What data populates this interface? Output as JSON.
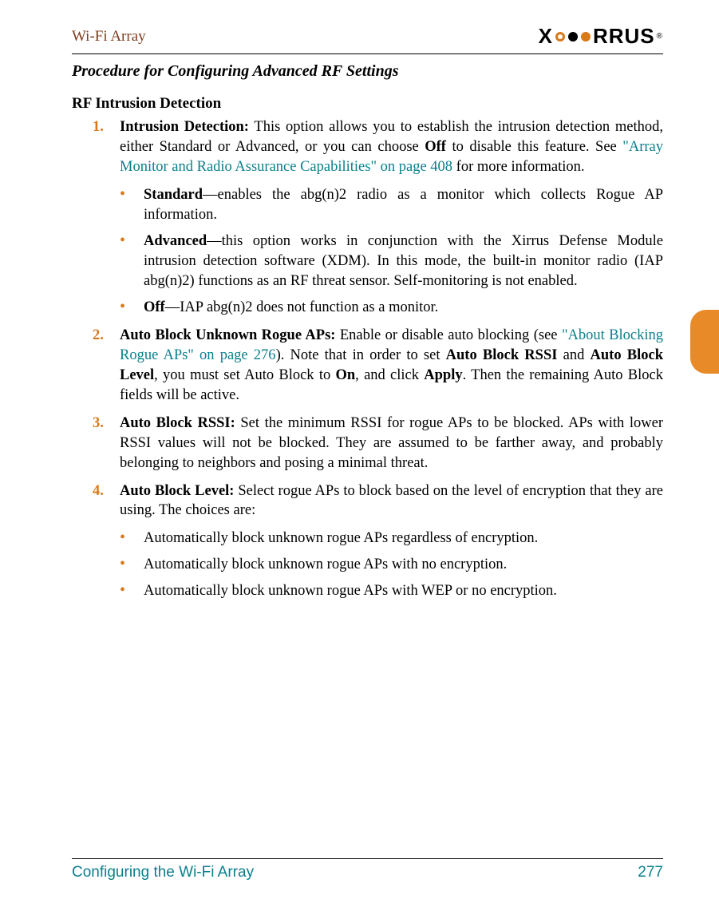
{
  "header": {
    "running_title": "Wi-Fi Array",
    "logo_left": "X",
    "logo_right": "RRUS",
    "logo_reg": "®"
  },
  "proc_title": "Procedure for Configuring Advanced RF Settings",
  "section_rf": "RF Intrusion Detection",
  "items": {
    "n1": {
      "num": "1.",
      "lead": "Intrusion Detection:",
      "t1": " This option allows you to establish the intrusion detection method, either Standard or Advanced, or you can choose ",
      "off_b": "Off",
      "t2": " to disable this feature. See ",
      "link": "\"Array Monitor and Radio Assurance Capabilities\" on page 408",
      "t3": " for more information."
    },
    "b1": {
      "lead": "Standard",
      "text": "—enables the abg(n)2 radio as a monitor which collects Rogue AP information."
    },
    "b2": {
      "lead": "Advanced",
      "text": "—this option works in conjunction with the Xirrus Defense Module intrusion detection software (XDM). In this mode, the built-in monitor radio (IAP abg(n)2) functions as an RF threat sensor. Self-monitoring is not enabled."
    },
    "b3": {
      "lead": "Off",
      "text": "—IAP abg(n)2 does not function as a monitor."
    },
    "n2": {
      "num": "2.",
      "lead": "Auto Block Unknown Rogue APs:",
      "t1": " Enable or disable auto blocking (see ",
      "link": "\"About Blocking Rogue APs\" on page 276",
      "t2": "). Note that in order to set ",
      "b1": "Auto Block RSSI",
      "and": " and ",
      "b2": "Auto Block Level",
      "t3": ", you must set Auto Block to ",
      "on_b": "On",
      "t4": ", and click ",
      "apply_b": "Apply",
      "t5": ". Then the remaining Auto Block fields will be active."
    },
    "n3": {
      "num": "3.",
      "lead": "Auto Block RSSI:",
      "text": " Set the minimum RSSI for rogue APs to be blocked. APs with lower RSSI values will not be blocked. They are assumed to be farther away, and probably belonging to neighbors and posing a minimal threat."
    },
    "n4": {
      "num": "4.",
      "lead": "Auto Block Level:",
      "text": " Select rogue APs to block based on the level of encryption that they are using. The choices are:"
    },
    "b4": {
      "text": "Automatically block unknown rogue APs regardless of encryption."
    },
    "b5": {
      "text": "Automatically block unknown rogue APs with no encryption."
    },
    "b6": {
      "text": "Automatically block unknown rogue APs with WEP or no encryption."
    }
  },
  "footer": {
    "left": "Configuring the Wi-Fi Array",
    "right": "277"
  }
}
